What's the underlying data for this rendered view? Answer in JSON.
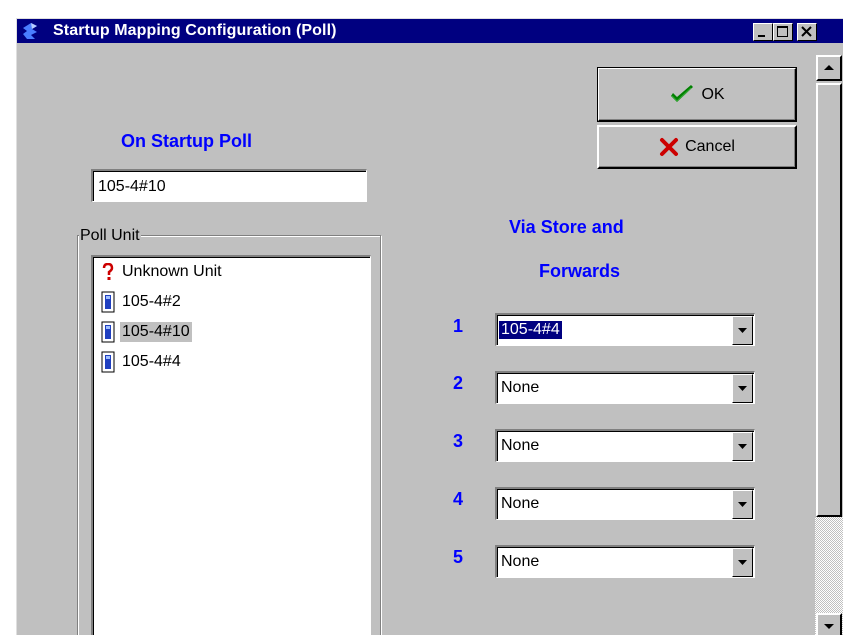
{
  "window": {
    "title": "Startup Mapping Configuration (Poll)",
    "controls": [
      "minimize-icon",
      "maximize-icon",
      "close-icon"
    ]
  },
  "buttons": {
    "ok_label": "OK",
    "cancel_label": "Cancel"
  },
  "startup": {
    "heading": "On Startup Poll",
    "value": "105-4#10"
  },
  "poll_unit": {
    "label": "Poll Unit",
    "items": [
      {
        "label": "Unknown Unit",
        "icon": "question-mark-icon",
        "selected": false
      },
      {
        "label": "105-4#2",
        "icon": "unit-device-icon",
        "selected": false
      },
      {
        "label": "105-4#10",
        "icon": "unit-device-icon",
        "selected": true
      },
      {
        "label": "105-4#4",
        "icon": "unit-device-icon",
        "selected": false
      }
    ]
  },
  "via": {
    "heading_line1": "Via Store and",
    "heading_line2": "Forwards",
    "rows": [
      {
        "num": "1",
        "value": "105-4#4"
      },
      {
        "num": "2",
        "value": "None"
      },
      {
        "num": "3",
        "value": "None"
      },
      {
        "num": "4",
        "value": "None"
      },
      {
        "num": "5",
        "value": "None"
      }
    ]
  },
  "colors": {
    "titlebar": "#000080",
    "face": "#c0c0c0",
    "heading_blue": "#0000ff",
    "ok_check": "#008000",
    "cancel_x": "#cc0000"
  }
}
